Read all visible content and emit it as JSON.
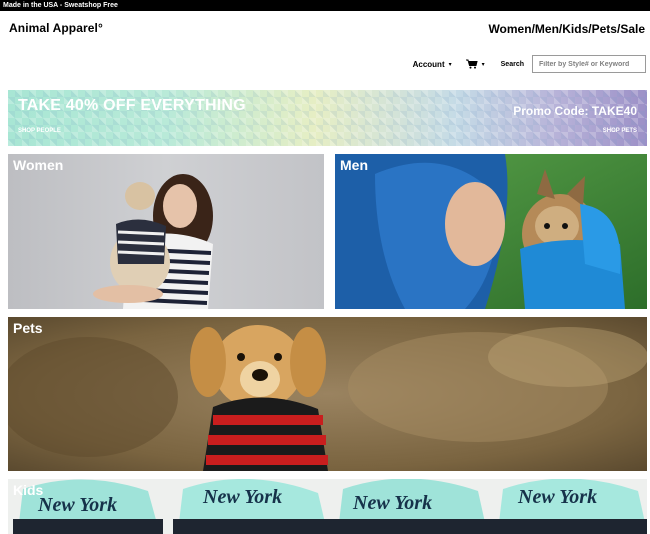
{
  "topbar": {
    "text": "Made in the USA - Sweatshop Free"
  },
  "header": {
    "logo": "Animal Apparel°",
    "nav": [
      {
        "label": "Women"
      },
      {
        "label": "Men"
      },
      {
        "label": "Kids"
      },
      {
        "label": "Pets"
      },
      {
        "label": "Sale"
      }
    ],
    "separator": "/"
  },
  "utility": {
    "account_label": "Account",
    "search_label": "Search",
    "search_placeholder": "Filter by Style# or Keyword",
    "search_value": ""
  },
  "promo": {
    "title": "TAKE 40% OFF EVERYTHING",
    "code": "Promo Code: TAKE40",
    "shop_people": "SHOP PEOPLE",
    "shop_pets": "SHOP PETS"
  },
  "tiles": {
    "women": "Women",
    "men": "Men",
    "pets": "Pets",
    "kids": "Kids"
  },
  "colors": {
    "topbar": "#000000",
    "promo_text": "#ffffff"
  }
}
